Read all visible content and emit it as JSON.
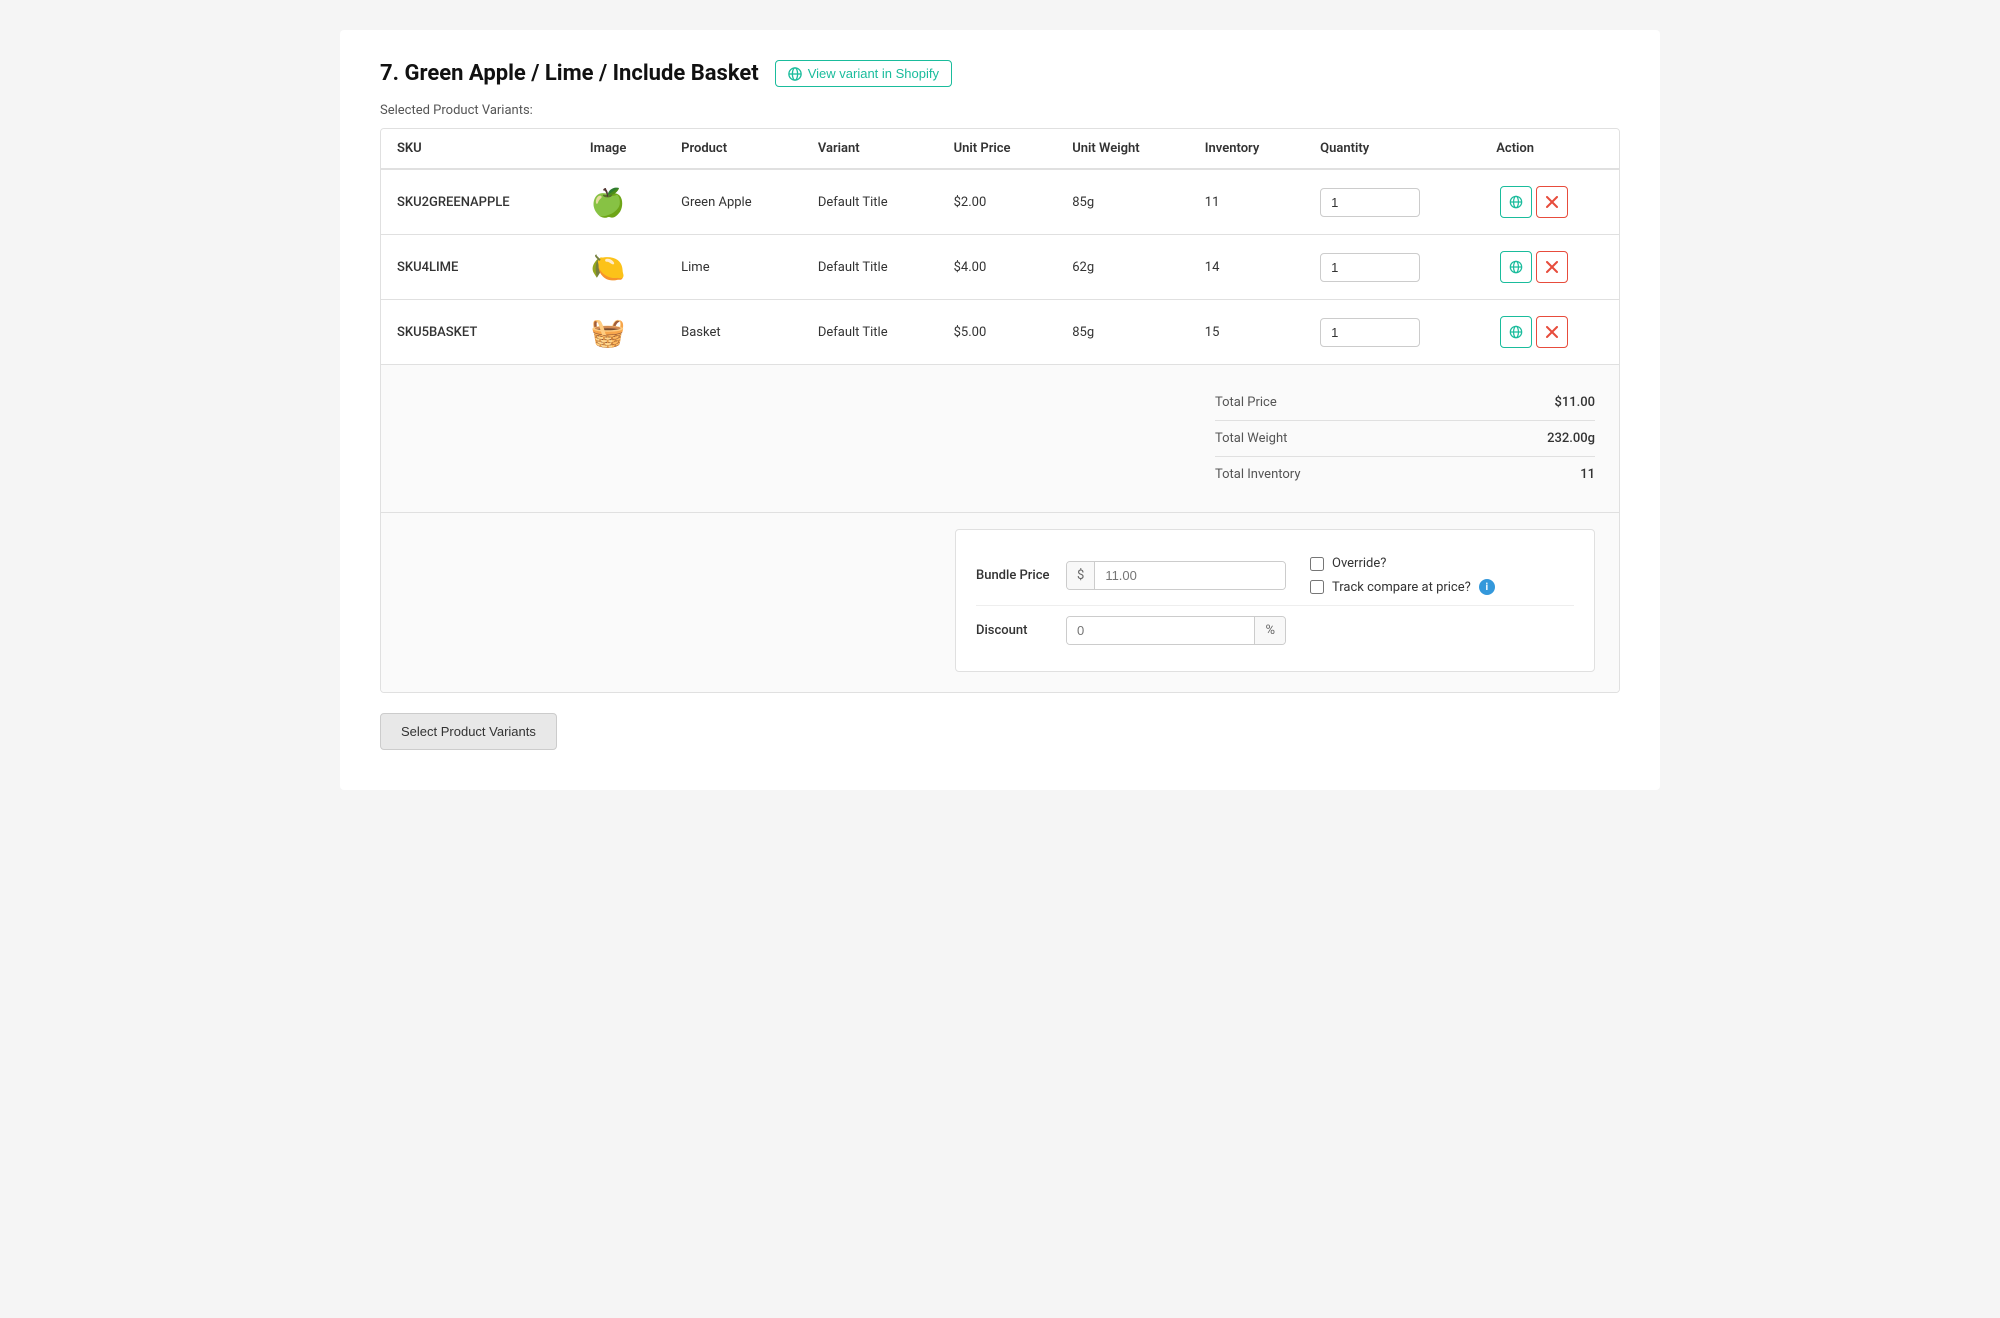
{
  "header": {
    "title": "7. Green Apple / Lime / Include Basket",
    "shopify_link_label": "View variant in Shopify"
  },
  "selected_label": "Selected Product Variants:",
  "table": {
    "columns": [
      "SKU",
      "Image",
      "Product",
      "Variant",
      "Unit Price",
      "Unit Weight",
      "Inventory",
      "Quantity",
      "Action"
    ],
    "rows": [
      {
        "sku": "SKU2GREENAPPLE",
        "image_emoji": "🍏",
        "product": "Green Apple",
        "variant": "Default Title",
        "unit_price": "$2.00",
        "unit_weight": "85g",
        "inventory": "11",
        "quantity": "1"
      },
      {
        "sku": "SKU4LIME",
        "image_emoji": "🍋",
        "product": "Lime",
        "variant": "Default Title",
        "unit_price": "$4.00",
        "unit_weight": "62g",
        "inventory": "14",
        "quantity": "1"
      },
      {
        "sku": "SKU5BASKET",
        "image_emoji": "🧺",
        "product": "Basket",
        "variant": "Default Title",
        "unit_price": "$5.00",
        "unit_weight": "85g",
        "inventory": "15",
        "quantity": "1"
      }
    ]
  },
  "totals": {
    "total_price_label": "Total Price",
    "total_price_value": "$11.00",
    "total_weight_label": "Total Weight",
    "total_weight_value": "232.00g",
    "total_inventory_label": "Total Inventory",
    "total_inventory_value": "11"
  },
  "bundle": {
    "price_label": "Bundle Price",
    "price_prefix": "$",
    "price_placeholder": "11.00",
    "override_label": "Override?",
    "track_compare_label": "Track compare at price?",
    "discount_label": "Discount",
    "discount_placeholder": "0",
    "discount_suffix": "%"
  },
  "select_variants_btn": "Select Product Variants",
  "colors": {
    "teal": "#1abc9c",
    "red": "#e74c3c",
    "blue": "#3498db"
  }
}
